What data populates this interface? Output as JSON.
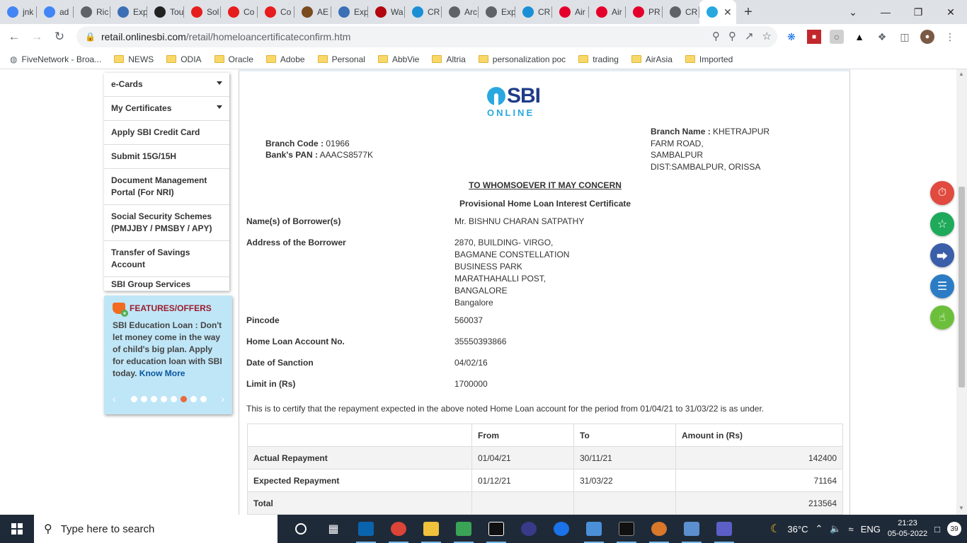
{
  "tabs": [
    {
      "label": "jnk",
      "icon": "google-icon",
      "color": "#4285f4"
    },
    {
      "label": "ad",
      "icon": "google-icon",
      "color": "#4285f4"
    },
    {
      "label": "Ric",
      "icon": "generic-site-icon",
      "color": "#5f6368"
    },
    {
      "label": "Exp",
      "icon": "generic-site-icon",
      "color": "#3b6fb6"
    },
    {
      "label": "Tou",
      "icon": "generic-site-icon",
      "color": "#222222"
    },
    {
      "label": "Sol",
      "icon": "adobe-icon",
      "color": "#e61d1d"
    },
    {
      "label": "Co",
      "icon": "adobe-icon",
      "color": "#e61d1d"
    },
    {
      "label": "Co",
      "icon": "adobe-icon",
      "color": "#e61d1d"
    },
    {
      "label": "AE",
      "icon": "generic-site-icon",
      "color": "#7a4b1e"
    },
    {
      "label": "Exp",
      "icon": "generic-site-icon",
      "color": "#3b6fb6"
    },
    {
      "label": "Wa",
      "icon": "netflix-icon",
      "color": "#b20710"
    },
    {
      "label": "CR",
      "icon": "generic-site-icon",
      "color": "#1a8fd6"
    },
    {
      "label": "Arc",
      "icon": "chrome-globe-icon",
      "color": "#5f6368"
    },
    {
      "label": "Exp",
      "icon": "chrome-globe-icon",
      "color": "#5f6368"
    },
    {
      "label": "CR",
      "icon": "generic-site-icon",
      "color": "#1a8fd6"
    },
    {
      "label": "Air",
      "icon": "airasia-icon",
      "color": "#e4002b"
    },
    {
      "label": "Air",
      "icon": "airasia-icon",
      "color": "#e4002b"
    },
    {
      "label": "PR",
      "icon": "airasia-icon",
      "color": "#e4002b"
    },
    {
      "label": "CR",
      "icon": "chrome-globe-icon",
      "color": "#5f6368"
    }
  ],
  "active_tab": {
    "icon": "sbi-icon",
    "color": "#29a8e0"
  },
  "url": {
    "host": "retail.onlinesbi.com",
    "path": "/retail/homeloancertificateconfirm.htm"
  },
  "bookmarks": [
    {
      "label": "FiveNetwork - Broa...",
      "type": "globe"
    },
    {
      "label": "NEWS",
      "type": "folder"
    },
    {
      "label": "ODIA",
      "type": "folder"
    },
    {
      "label": "Oracle",
      "type": "folder"
    },
    {
      "label": "Adobe",
      "type": "folder"
    },
    {
      "label": "Personal",
      "type": "folder"
    },
    {
      "label": "AbbVie",
      "type": "folder"
    },
    {
      "label": "Altria",
      "type": "folder"
    },
    {
      "label": "personalization poc",
      "type": "folder"
    },
    {
      "label": "trading",
      "type": "folder"
    },
    {
      "label": "AirAsia",
      "type": "folder"
    },
    {
      "label": "Imported",
      "type": "folder"
    }
  ],
  "leftnav": [
    {
      "label": "e-Cards",
      "caret": true
    },
    {
      "label": "My Certificates",
      "caret": true
    },
    {
      "label": "Apply SBI Credit Card",
      "caret": false
    },
    {
      "label": "Submit 15G/15H",
      "caret": false
    },
    {
      "label": "Document Management Portal (For NRI)",
      "caret": false
    },
    {
      "label": "Social Security Schemes (PMJJBY / PMSBY / APY)",
      "caret": false
    },
    {
      "label": "Transfer of Savings Account",
      "caret": false
    },
    {
      "label": "SBI Group Services",
      "caret": false
    }
  ],
  "features": {
    "heading": "FEATURES/OFFERS",
    "text": "SBI Education Loan : Don't let money come in the way of child's big plan. Apply for education loan with SBI today.",
    "link": "Know More",
    "dots_total": 8,
    "dot_active": 5
  },
  "logo": {
    "main": "SBI",
    "sub": "ONLINE"
  },
  "branch": {
    "code_label": "Branch Code :",
    "code": "01966",
    "pan_label": "Bank's PAN :",
    "pan": "AAACS8577K",
    "name_label": "Branch Name :",
    "name": "KHETRAJPUR",
    "addr1": "FARM ROAD,",
    "addr2": "SAMBALPUR",
    "addr3": "DIST:SAMBALPUR, ORISSA"
  },
  "cert": {
    "heading": "TO WHOMSOEVER IT MAY CONCERN",
    "subheading": "Provisional Home Loan Interest Certificate",
    "borrower_label": "Name(s) of Borrower(s)",
    "borrower": "Mr. BISHNU CHARAN SATPATHY",
    "address_label": "Address of the Borrower",
    "address": [
      "2870, BUILDING- VIRGO,",
      "BAGMANE CONSTELLATION",
      "BUSINESS PARK",
      "MARATHAHALLI POST,",
      "BANGALORE",
      "Bangalore"
    ],
    "pincode_label": "Pincode",
    "pincode": "560037",
    "account_label": "Home Loan Account No.",
    "account": "35550393866",
    "sanction_label": "Date of Sanction",
    "sanction": "04/02/16",
    "limit_label": "Limit in (Rs)",
    "limit": "1700000",
    "certify_text": "This is to certify that the repayment expected in the above noted Home Loan account for the period from 01/04/21 to 31/03/22 is as under."
  },
  "table": {
    "headers": [
      "",
      "From",
      "To",
      "Amount in (Rs)"
    ],
    "rows": [
      {
        "label": "Actual Repayment",
        "from": "01/04/21",
        "to": "30/11/21",
        "amount": "142400"
      },
      {
        "label": "Expected Repayment",
        "from": "01/12/21",
        "to": "31/03/22",
        "amount": "71164"
      },
      {
        "label": "Total",
        "from": "",
        "to": "",
        "amount": "213564"
      }
    ]
  },
  "float_icons": [
    {
      "name": "timer-icon",
      "color": "#e04a3f"
    },
    {
      "name": "lightbulb-icon",
      "color": "#1eaa5a"
    },
    {
      "name": "share-icon",
      "color": "#3b5ea8"
    },
    {
      "name": "profile-list-icon",
      "color": "#2b7cc4"
    },
    {
      "name": "thumbs-up-icon",
      "color": "#6cbf3a"
    }
  ],
  "taskbar": {
    "search_placeholder": "Type here to search",
    "weather": "36°C",
    "lang": "ENG",
    "time": "21:23",
    "date": "05-05-2022",
    "notifications": "39"
  }
}
